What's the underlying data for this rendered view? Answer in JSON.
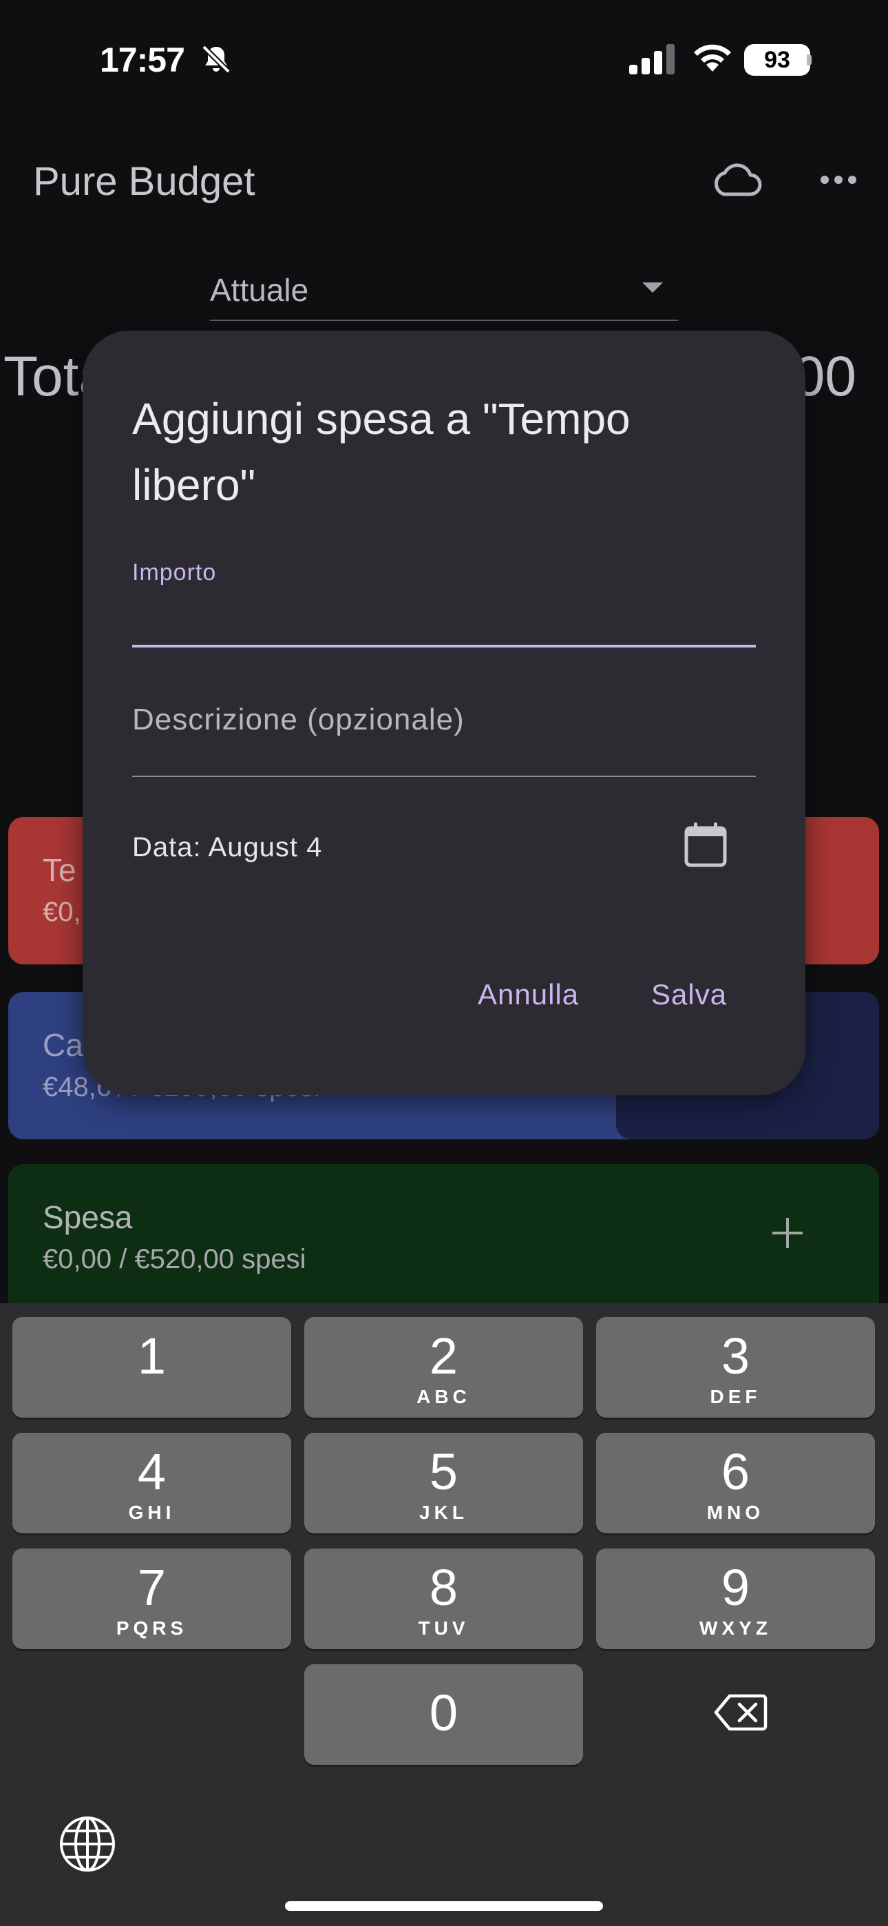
{
  "status_bar": {
    "time": "17:57",
    "battery": "93"
  },
  "app": {
    "title": "Pure Budget",
    "period_selected": "Attuale",
    "total_left": "Tota",
    "total_right": ",00"
  },
  "categories": [
    {
      "name": "Te",
      "amount": "€0,"
    },
    {
      "name": "Ca",
      "amount": "€48,6↑ / €100,00 spesi"
    },
    {
      "name": "Spesa",
      "amount": "€0,00 / €520,00 spesi"
    }
  ],
  "dialog": {
    "title": "Aggiungi spesa a \"Tempo libero\"",
    "amount_label": "Importo",
    "amount_value": "",
    "description_placeholder": "Descrizione (opzionale)",
    "date_text": "Data: August 4",
    "cancel_label": "Annulla",
    "save_label": "Salva"
  },
  "keyboard": {
    "keys": [
      {
        "digit": "1",
        "letters": ""
      },
      {
        "digit": "2",
        "letters": "ABC"
      },
      {
        "digit": "3",
        "letters": "DEF"
      },
      {
        "digit": "4",
        "letters": "GHI"
      },
      {
        "digit": "5",
        "letters": "JKL"
      },
      {
        "digit": "6",
        "letters": "MNO"
      },
      {
        "digit": "7",
        "letters": "PQRS"
      },
      {
        "digit": "8",
        "letters": "TUV"
      },
      {
        "digit": "9",
        "letters": "WXYZ"
      },
      {
        "digit": "0",
        "letters": ""
      }
    ]
  },
  "colors": {
    "accent": "#cbb5f0",
    "dialog_bg": "#2c2b31",
    "category_red": "#a83734",
    "category_blue": "#2f4080",
    "category_green": "#0e2e13"
  },
  "icons": [
    "bell-slash-icon",
    "signal-icon",
    "wifi-icon",
    "cloud-icon",
    "more-icon",
    "calendar-icon",
    "plus-icon",
    "backspace-icon",
    "globe-icon"
  ]
}
